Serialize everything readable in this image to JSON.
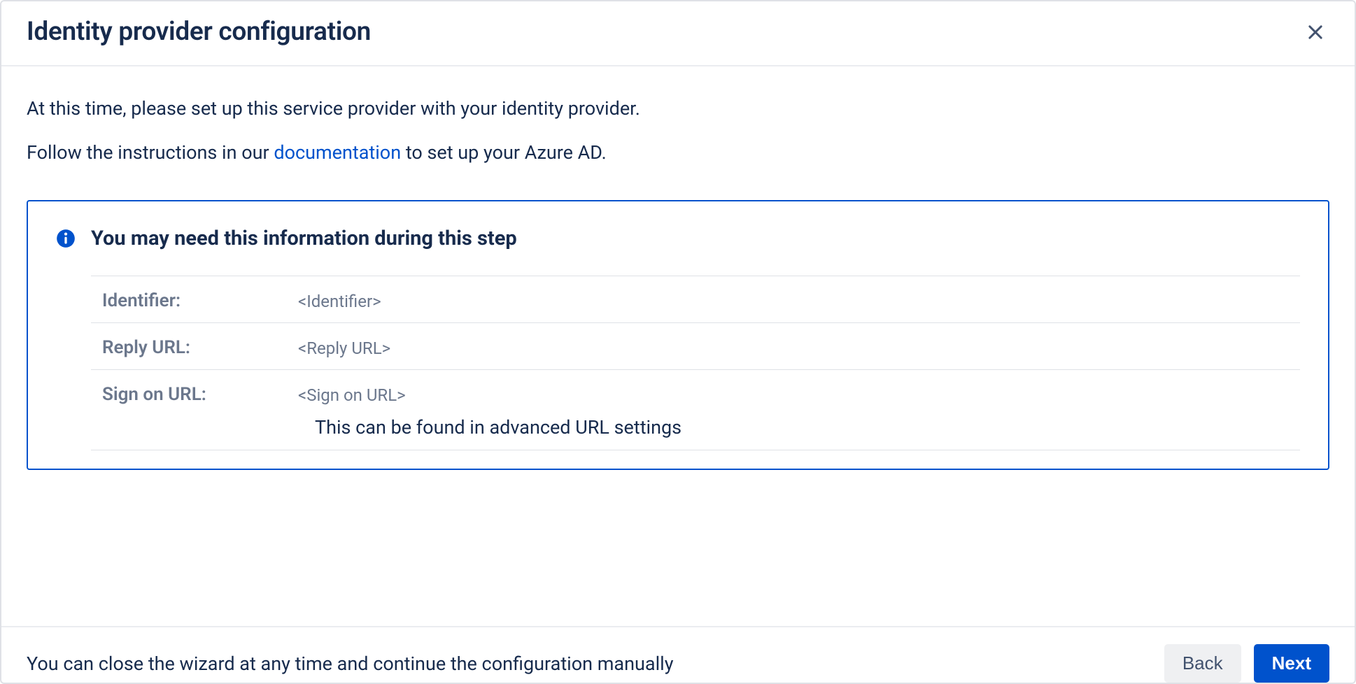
{
  "header": {
    "title": "Identity provider configuration"
  },
  "body": {
    "intro1": "At this time, please set up this service provider with your identity provider.",
    "intro2_prefix": "Follow the instructions in our ",
    "doc_link_label": "documentation",
    "intro2_suffix": " to set up your Azure AD.",
    "panel_title": "You may need this information during this step",
    "rows": [
      {
        "label": "Identifier:",
        "value": "<Identifier>",
        "note": ""
      },
      {
        "label": "Reply URL:",
        "value": "<Reply URL>",
        "note": ""
      },
      {
        "label": "Sign on URL:",
        "value": "<Sign on URL>",
        "note": "This can be found in advanced URL settings"
      }
    ]
  },
  "footer": {
    "hint": "You can close the wizard at any time and continue the configuration manually",
    "back_label": "Back",
    "next_label": "Next"
  }
}
